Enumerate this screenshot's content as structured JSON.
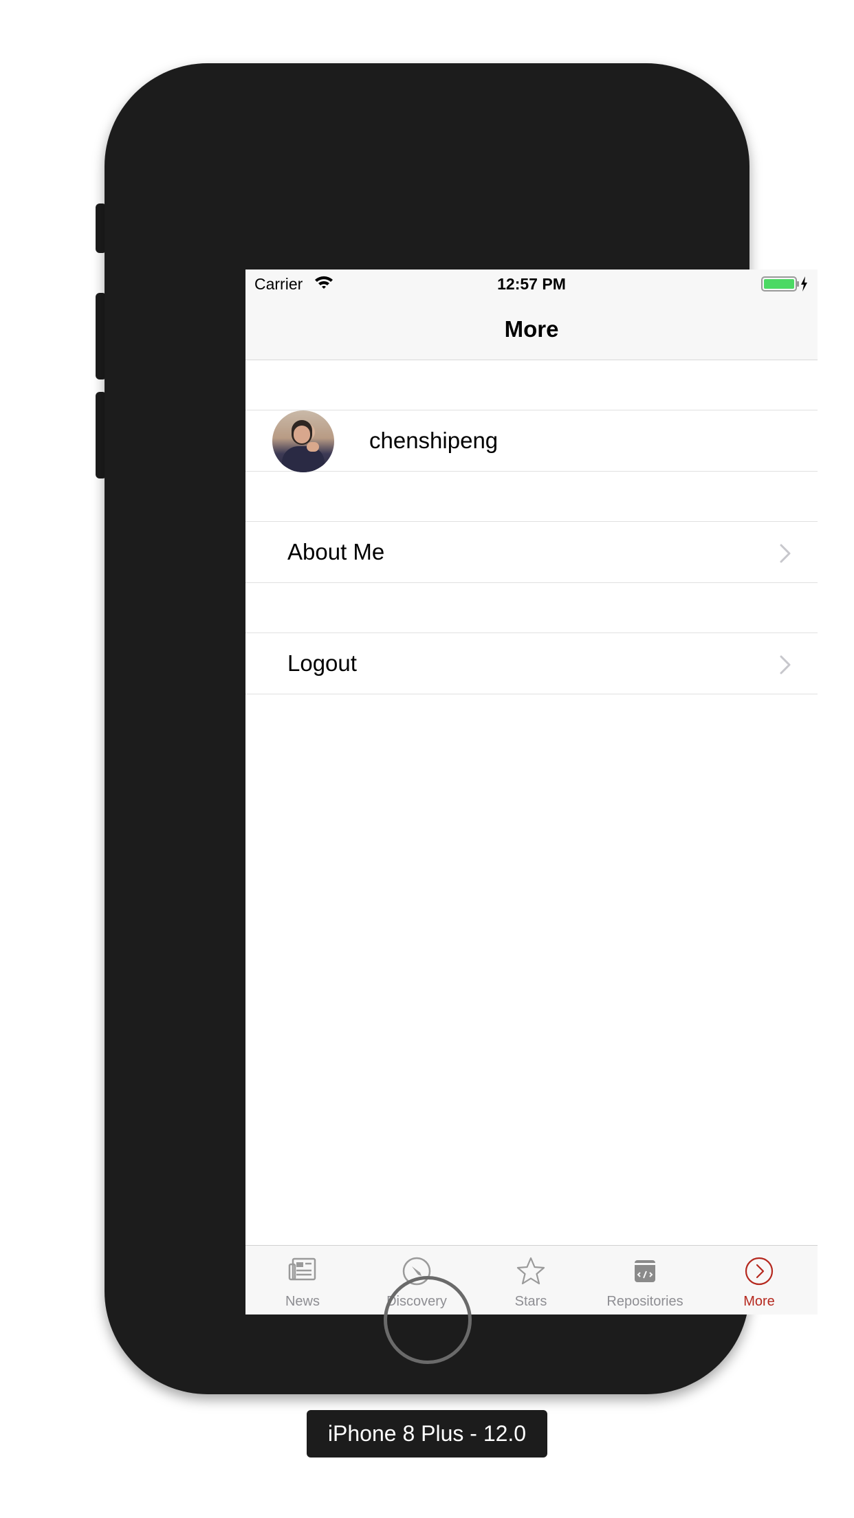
{
  "status_bar": {
    "carrier": "Carrier",
    "time": "12:57 PM",
    "battery_color": "#4cd964"
  },
  "nav_bar": {
    "title": "More"
  },
  "profile": {
    "username": "chenshipeng",
    "avatar_icon": "user-avatar"
  },
  "menu": [
    {
      "label": "About Me",
      "icon": "chevron-right-icon"
    },
    {
      "label": "Logout",
      "icon": "chevron-right-icon"
    }
  ],
  "tab_bar": {
    "active_color": "#b5281e",
    "inactive_color": "#8e8e93",
    "tabs": [
      {
        "label": "News",
        "icon": "newspaper-icon",
        "active": false
      },
      {
        "label": "Discovery",
        "icon": "compass-icon",
        "active": false
      },
      {
        "label": "Stars",
        "icon": "star-icon",
        "active": false
      },
      {
        "label": "Repositories",
        "icon": "repository-icon",
        "active": false
      },
      {
        "label": "More",
        "icon": "more-circle-icon",
        "active": true
      }
    ]
  },
  "device": {
    "label": "iPhone 8 Plus - 12.0"
  }
}
